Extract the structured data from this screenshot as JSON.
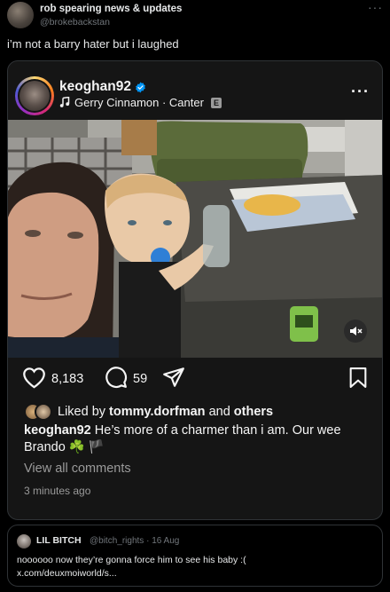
{
  "tweet": {
    "author_name": "rob spearing news & updates",
    "author_handle": "@brokebackstan",
    "text": "i’m not a barry hater but i laughed",
    "more_icon": "more-horizontal-icon"
  },
  "instagram_post": {
    "username": "keoghan92",
    "verified": true,
    "music": "Gerry Cinnamon · Canter",
    "explicit_label": "E",
    "likes_count": "8,183",
    "comments_count": "59",
    "liked_by_prefix": "Liked by ",
    "liked_by_user": "tommy.dorfman",
    "liked_by_and": " and ",
    "liked_by_others": "others",
    "caption_user": "keoghan92",
    "caption_text": " He’s more of a charmer than i am. Our wee Brando ☘️ 🏴",
    "view_all_comments": "View all comments",
    "time_ago": "3 minutes ago",
    "icons": {
      "like": "heart-icon",
      "comment": "comment-bubble-icon",
      "share": "paper-plane-icon",
      "save": "bookmark-icon",
      "mute": "speaker-muted-icon",
      "music": "music-note-icon"
    }
  },
  "quoted_tweet": {
    "author_name": "LIL BITCH",
    "author_handle": "@bitch_rights",
    "date": "16 Aug",
    "text_line1": "noooooo now they’re gonna force him to see his baby :(",
    "text_line2": "x.com/deuxmoiworld/s..."
  },
  "colors": {
    "background": "#000000",
    "card": "#151515",
    "border": "#2f3336",
    "muted": "#71767b",
    "verified_blue": "#0095f6"
  }
}
